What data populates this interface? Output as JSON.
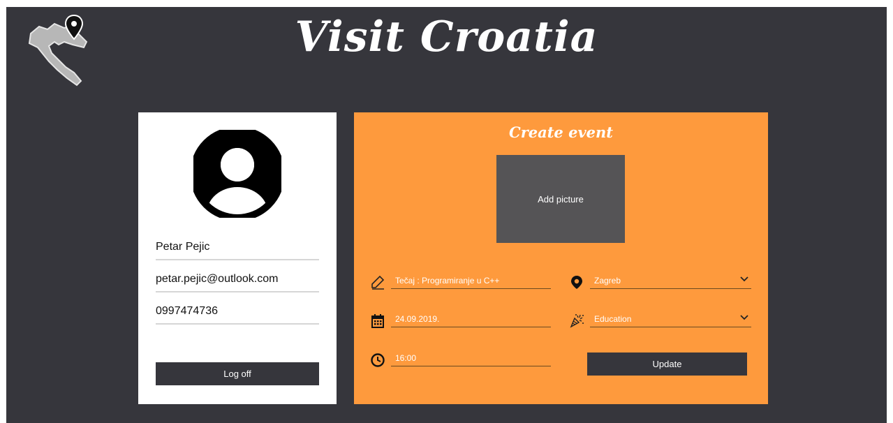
{
  "header": {
    "title": "Visit Croatia",
    "logo_icon": "croatia-map-pin-icon"
  },
  "profile": {
    "avatar_icon": "user-avatar-icon",
    "name": "Petar Pejic",
    "email": "petar.pejic@outlook.com",
    "phone": "0997474736",
    "logoff_label": "Log off"
  },
  "event": {
    "title": "Create event",
    "add_picture_label": "Add picture",
    "name_value": "Tečaj : Programiranje u C++",
    "location_value": "Zagreb",
    "date_value": "24.09.2019.",
    "category_value": "Education",
    "time_value": "16:00",
    "update_label": "Update"
  },
  "colors": {
    "background": "#36363c",
    "accent": "#fe9a3d",
    "card": "#ffffff",
    "picture_box": "#555456"
  }
}
